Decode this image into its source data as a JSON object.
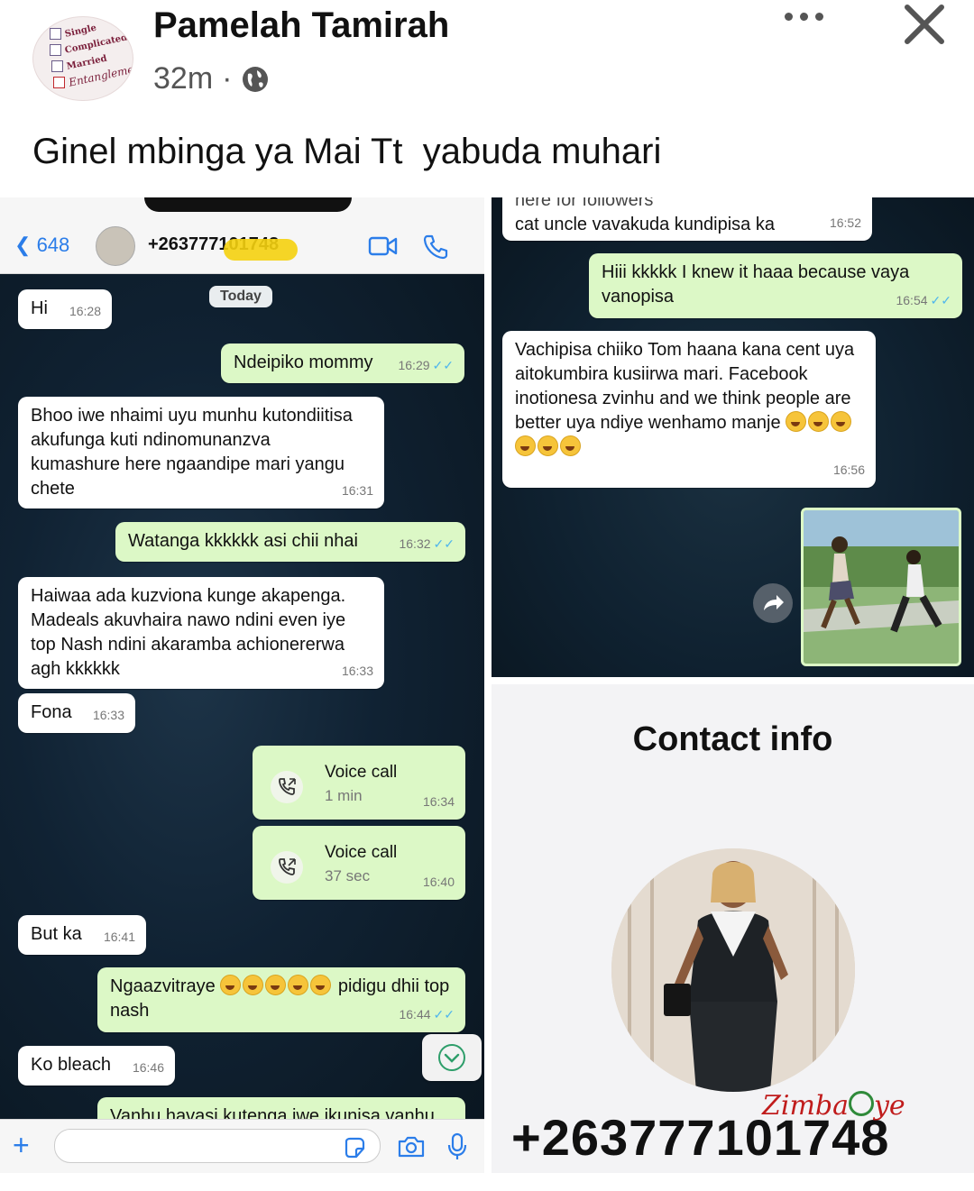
{
  "post": {
    "author": "Pamelah Tamirah",
    "time": "32m",
    "separator": "·",
    "text": "Ginel mbinga ya Mai Tt  yabuda muhari",
    "avatar_text": [
      "Single",
      "Complicated",
      "Married",
      "Entanglement"
    ]
  },
  "left_chat": {
    "back_count": "648",
    "contact_number": "+263777101748",
    "date_label": "Today",
    "messages": [
      {
        "dir": "in",
        "text": "Hi",
        "time": "16:28"
      },
      {
        "dir": "out",
        "text": "Ndeipiko mommy",
        "time": "16:29"
      },
      {
        "dir": "in",
        "text": "Bhoo iwe nhaimi uyu munhu kutondiitisa akufunga kuti ndinomunanzva kumashure here ngaandipe mari yangu chete",
        "time": "16:31"
      },
      {
        "dir": "out",
        "text": "Watanga kkkkkk asi chii nhai",
        "time": "16:32"
      },
      {
        "dir": "in",
        "text": "Haiwaa ada kuzviona kunge akapenga. Madeals akuvhaira nawo ndini even iye top Nash ndini akaramba achionererwa agh kkkkkk",
        "time": "16:33"
      },
      {
        "dir": "in",
        "text": "Fona",
        "time": "16:33"
      },
      {
        "dir": "out",
        "type": "call",
        "title": "Voice call",
        "duration": "1 min",
        "time": "16:34"
      },
      {
        "dir": "out",
        "type": "call",
        "title": "Voice call",
        "duration": "37 sec",
        "time": "16:40"
      },
      {
        "dir": "in",
        "text": "But ka",
        "time": "16:41"
      },
      {
        "dir": "out",
        "text_before": "Ngaazvitraye",
        "text_after": "pidigu dhii top nash",
        "emoji_count": 5,
        "time": "16:44"
      },
      {
        "dir": "in",
        "text": "Ko bleach",
        "time": "16:46"
      },
      {
        "dir": "out",
        "text": "Vanhu havasi kutenga iwe ikunisa vanhu",
        "time": ""
      }
    ]
  },
  "right_chat": {
    "messages": [
      {
        "dir": "in",
        "text_top": "here for followers",
        "text": "cat uncle vavakuda kundipisa ka",
        "time": "16:52"
      },
      {
        "dir": "out",
        "text": "Hiii kkkkk I knew it haaa because vaya vanopisa",
        "time": "16:54"
      },
      {
        "dir": "in",
        "text": "Vachipisa chiiko Tom haana kana cent uya aitokumbira kusiirwa mari. Facebook inotionesa zvinhu and we think people are better uya ndiye wenhamo manje",
        "emoji_count": 6,
        "time": "16:56"
      }
    ]
  },
  "contact": {
    "title": "Contact info",
    "number": "+263777101748",
    "watermark": "ZimbaCye"
  },
  "colors": {
    "incoming_bubble": "#ffffff",
    "outgoing_bubble": "#dcf8c6",
    "chat_bg": "#0f2130",
    "link_blue": "#2b7de9",
    "read_tick": "#4fb6ec"
  }
}
